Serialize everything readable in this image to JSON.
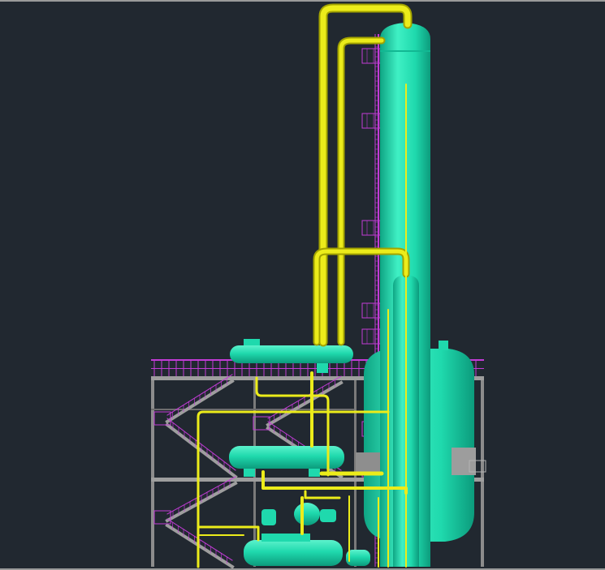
{
  "view": {
    "background": "#212830",
    "frame_color": "#9a9a9a"
  },
  "palette": {
    "vessel_fill": "#1fd9ad",
    "vessel_highlight": "#5cf2cc",
    "vessel_shadow": "#0c9b7c",
    "pipe": "#ecec1a",
    "pipe_shadow": "#a3a300",
    "rail": "#c23bd6",
    "steel": "#8c8c8c",
    "steel_light": "#b4b4b4",
    "equipment_grey": "#9d9d9d"
  },
  "components": {
    "column_main": "distillation-column-main",
    "column_secondary": "distillation-column-secondary",
    "drum_large": "vertical-drum-large",
    "exchanger_top": "horizontal-exchanger-top",
    "exchanger_mid": "horizontal-exchanger-middle",
    "exchanger_low": "horizontal-exchanger-low",
    "pump": "pump-skid",
    "structure": "steel-structure",
    "ladders": "ladder-cages",
    "piping": "process-piping"
  }
}
